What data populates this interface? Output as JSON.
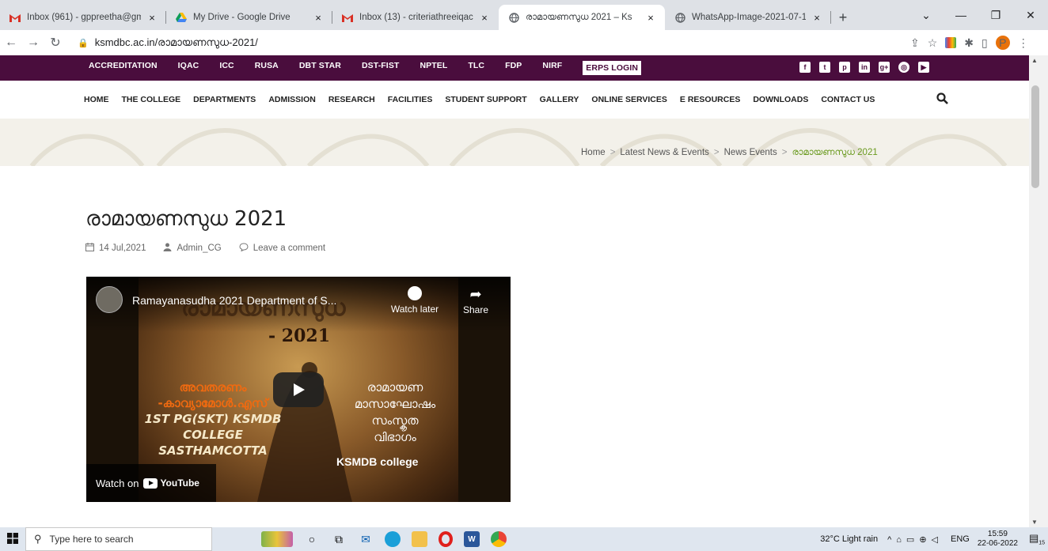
{
  "browser": {
    "tabs": [
      {
        "title": "Inbox (961) - gppreetha@gm",
        "icon": "gmail-icon",
        "active": false
      },
      {
        "title": "My Drive - Google Drive",
        "icon": "drive-icon",
        "active": false
      },
      {
        "title": "Inbox (13) - criteriathreeiqac",
        "icon": "gmail-icon",
        "active": false
      },
      {
        "title": "രാമായണസുധ 2021 – Ks",
        "icon": "globe-icon",
        "active": true
      },
      {
        "title": "WhatsApp-Image-2021-07-1",
        "icon": "globe-icon",
        "active": false
      }
    ],
    "close_glyph": "×",
    "new_tab_glyph": "+",
    "url": "ksmdbc.ac.in/രാമായണസുധ-2021/",
    "profile_initial": "P"
  },
  "topbar": {
    "links": [
      "ACCREDITATION",
      "IQAC",
      "ICC",
      "RUSA",
      "DBT STAR",
      "DST-FIST",
      "NPTEL",
      "TLC",
      "FDP",
      "NIRF"
    ],
    "erps_label": "ERPS LOGIN"
  },
  "mainnav": {
    "items": [
      "HOME",
      "THE COLLEGE",
      "DEPARTMENTS",
      "ADMISSION",
      "RESEARCH",
      "FACILITIES",
      "STUDENT SUPPORT",
      "GALLERY",
      "ONLINE SERVICES",
      "E RESOURCES",
      "DOWNLOADS",
      "CONTACT US"
    ]
  },
  "breadcrumb": {
    "items": [
      "Home",
      "Latest News & Events",
      "News Events"
    ],
    "separator": ">",
    "current": "രാമായണസുധ 2021"
  },
  "post": {
    "title": "രാമായണസുധ 2021",
    "date": "14 Jul,2021",
    "author": "Admin_CG",
    "comment_link": "Leave a comment"
  },
  "video": {
    "title": "Ramayanasudha 2021 Department of S...",
    "watch_later": "Watch later",
    "share": "Share",
    "heading_text": "രാമായണസുധ",
    "year_text": "- 2021",
    "left_caption_1": "അവതരണം",
    "left_caption_2": "-കാവ്യാമോൾ.എസ്",
    "left_caption_3": "1ST PG(SKT) KSMDB",
    "left_caption_4": "COLLEGE",
    "left_caption_5": "SASTHAMCOTTA",
    "right_caption_1": "രാമായണ",
    "right_caption_2": "മാസാഘോഷം",
    "right_caption_3": "സംസ്കൃത",
    "right_caption_4": "വിഭാഗം",
    "college_text": "KSMDB college",
    "watch_on": "Watch on",
    "youtube": "YouTube"
  },
  "taskbar": {
    "search_placeholder": "Type here to search",
    "weather": "32°C  Light rain",
    "language": "ENG",
    "time": "15:59",
    "date": "22-06-2022",
    "notification_count": "15"
  }
}
